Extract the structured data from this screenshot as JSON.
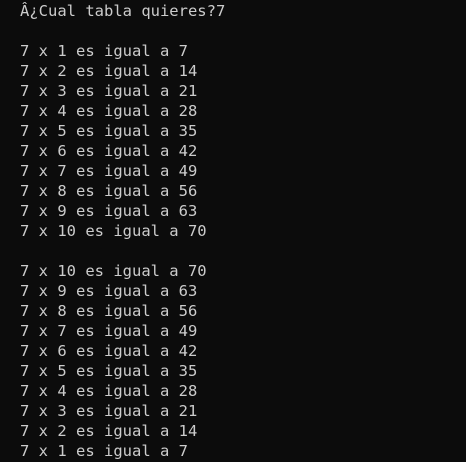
{
  "console": {
    "prompt": "Â¿Cual tabla quieres?7",
    "ascending": [
      "7 x 1 es igual a 7",
      "7 x 2 es igual a 14",
      "7 x 3 es igual a 21",
      "7 x 4 es igual a 28",
      "7 x 5 es igual a 35",
      "7 x 6 es igual a 42",
      "7 x 7 es igual a 49",
      "7 x 8 es igual a 56",
      "7 x 9 es igual a 63",
      "7 x 10 es igual a 70"
    ],
    "descending": [
      "7 x 10 es igual a 70",
      "7 x 9 es igual a 63",
      "7 x 8 es igual a 56",
      "7 x 7 es igual a 49",
      "7 x 6 es igual a 42",
      "7 x 5 es igual a 35",
      "7 x 4 es igual a 28",
      "7 x 3 es igual a 21",
      "7 x 2 es igual a 14",
      "7 x 1 es igual a 7"
    ]
  },
  "colors": {
    "background": "#0c0c0c",
    "text": "#cccccc"
  }
}
